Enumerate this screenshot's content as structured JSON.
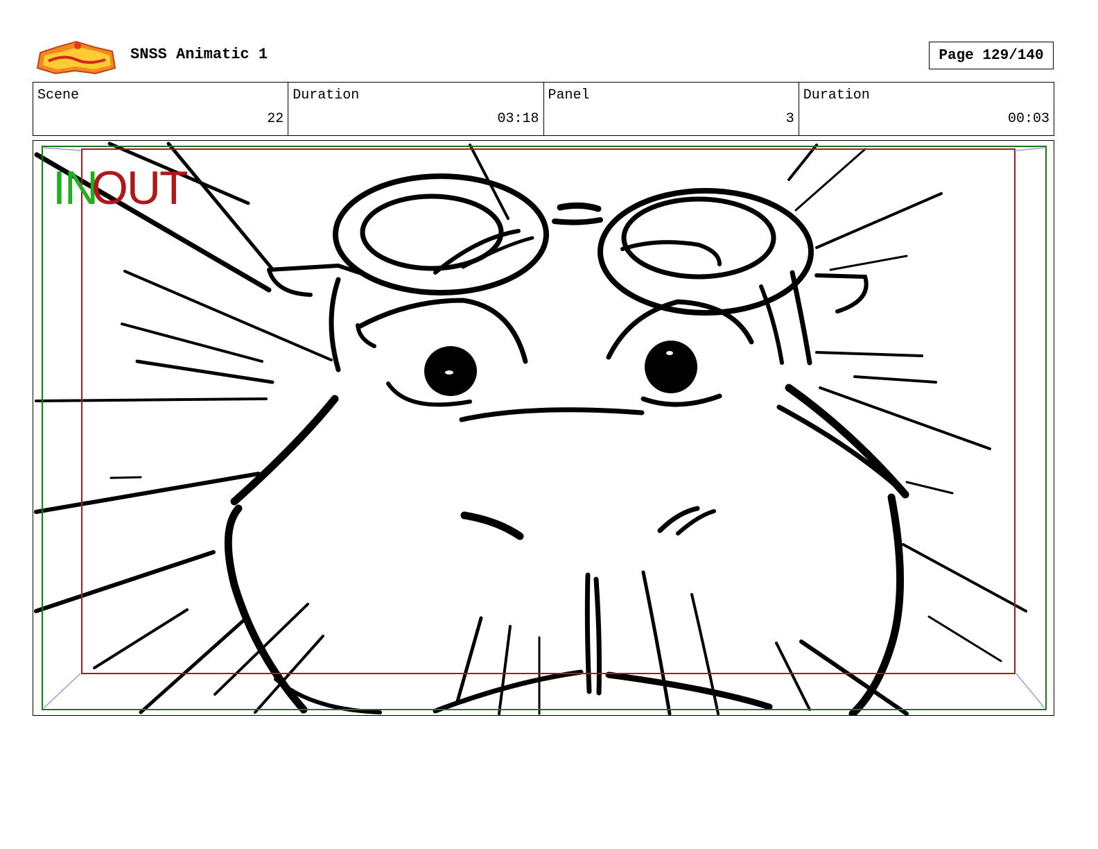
{
  "header": {
    "logo_icon": "show-logo-icon",
    "title": "SNSS Animatic 1",
    "page_label": "Page 129/140"
  },
  "info": [
    {
      "label": "Scene",
      "value": "22"
    },
    {
      "label": "Duration",
      "value": "03:18"
    },
    {
      "label": "Panel",
      "value": "3"
    },
    {
      "label": "Duration",
      "value": "00:03"
    }
  ],
  "panel": {
    "in_marker": "IN",
    "out_marker": "OUT",
    "colors": {
      "safe_frame": "#1a7a1a",
      "action_frame": "#b01818",
      "in_text": "#1fae1f",
      "out_text": "#b01818",
      "corner_arrows": "#9999dd"
    }
  }
}
